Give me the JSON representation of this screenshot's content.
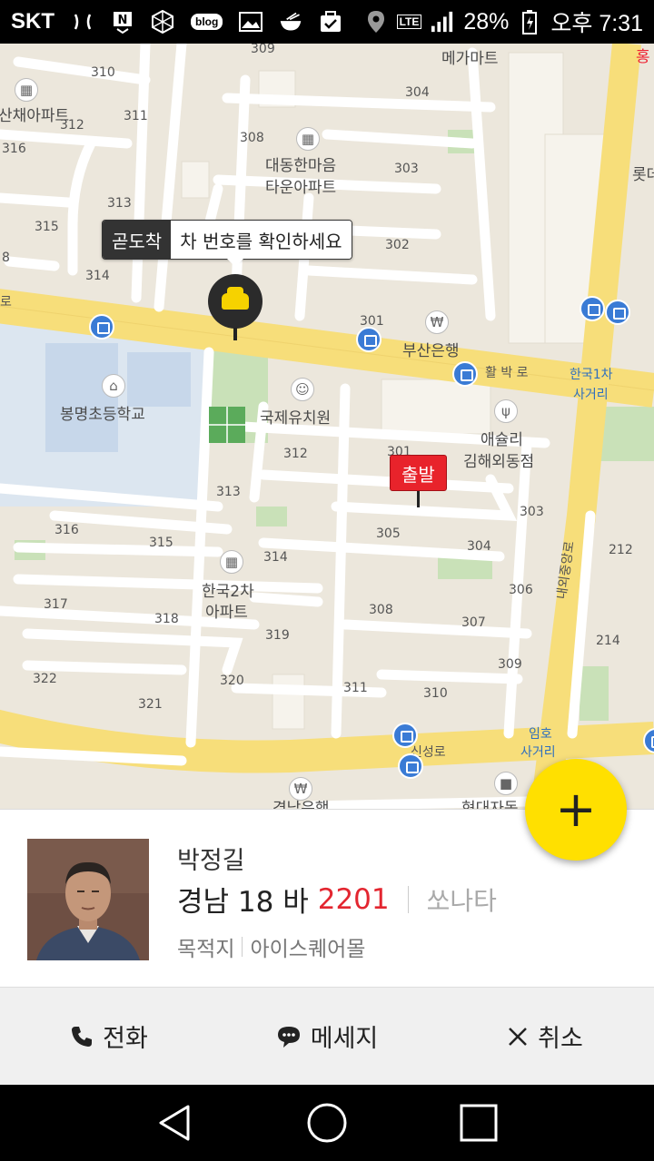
{
  "status_bar": {
    "carrier": "SKT",
    "network": "LTE",
    "battery": "28%",
    "time": "오후 7:31",
    "icons": [
      "n-notification-icon",
      "app-icon",
      "blog-icon",
      "gallery-icon",
      "food-icon",
      "task-icon",
      "location-icon",
      "signal-icon",
      "battery-icon"
    ]
  },
  "map": {
    "tooltip": {
      "status": "곧도착",
      "message": "차 번호를 확인하세요"
    },
    "start_marker": "출발",
    "labels": {
      "megamart": "메가마트",
      "apt1": "산채아파트",
      "daedong1": "대동한마음",
      "daedong2": "타운아파트",
      "busan_bank": "부산은행",
      "bongmyeong": "봉명초등학교",
      "kindergarten": "국제유치원",
      "aeshuri1": "애슐리",
      "aeshuri2": "김해외동점",
      "hanguk2_1": "한국2차",
      "hanguk2_2": "아파트",
      "hanguk1_1": "한국1차",
      "hanguk1_2": "사거리",
      "imho1": "임호",
      "imho2": "사거리",
      "road_hwangsan": "활 박 로",
      "road_sinseong": "신성로",
      "road_naeoe": "내외중앙로",
      "hyundai": "현대자동",
      "gyeongnam": "경남은행",
      "lotte": "롯데",
      "right_edge": "홍",
      "left_road": "로",
      "n309": "309",
      "n310": "310",
      "n304a": "304",
      "n311a": "311",
      "n312a": "312",
      "n316a": "316",
      "n308a": "308",
      "n303a": "303",
      "n313a": "313",
      "n315a": "315",
      "n302": "302",
      "n314a": "314",
      "n8": "8",
      "n301a": "301",
      "n312b": "312",
      "n301b": "301",
      "n313b": "313",
      "n303b": "303",
      "n316b": "316",
      "n315b": "315",
      "n314b": "314",
      "n305": "305",
      "n304b": "304",
      "n212": "212",
      "n306": "306",
      "n317": "317",
      "n318": "318",
      "n308b": "308",
      "n307": "307",
      "n319": "319",
      "n214": "214",
      "n309b": "309",
      "n322": "322",
      "n320": "320",
      "n311b": "311",
      "n310b": "310",
      "n321": "321"
    }
  },
  "fab": {
    "label": "+"
  },
  "driver": {
    "name": "박정길",
    "plate_prefix": "경남 18 바",
    "plate_number": "2201",
    "car_model": "쏘나타",
    "dest_label": "목적지",
    "destination": "아이스퀘어몰"
  },
  "actions": {
    "call": "전화",
    "message": "메세지",
    "cancel": "취소"
  },
  "colors": {
    "taxi_yellow": "#ffe000",
    "plate_red": "#e32630",
    "start_red": "#e8232b",
    "map_bg": "#ece7dc",
    "road_yellow": "#f7de7a",
    "bus_blue": "#3a7bd5"
  }
}
